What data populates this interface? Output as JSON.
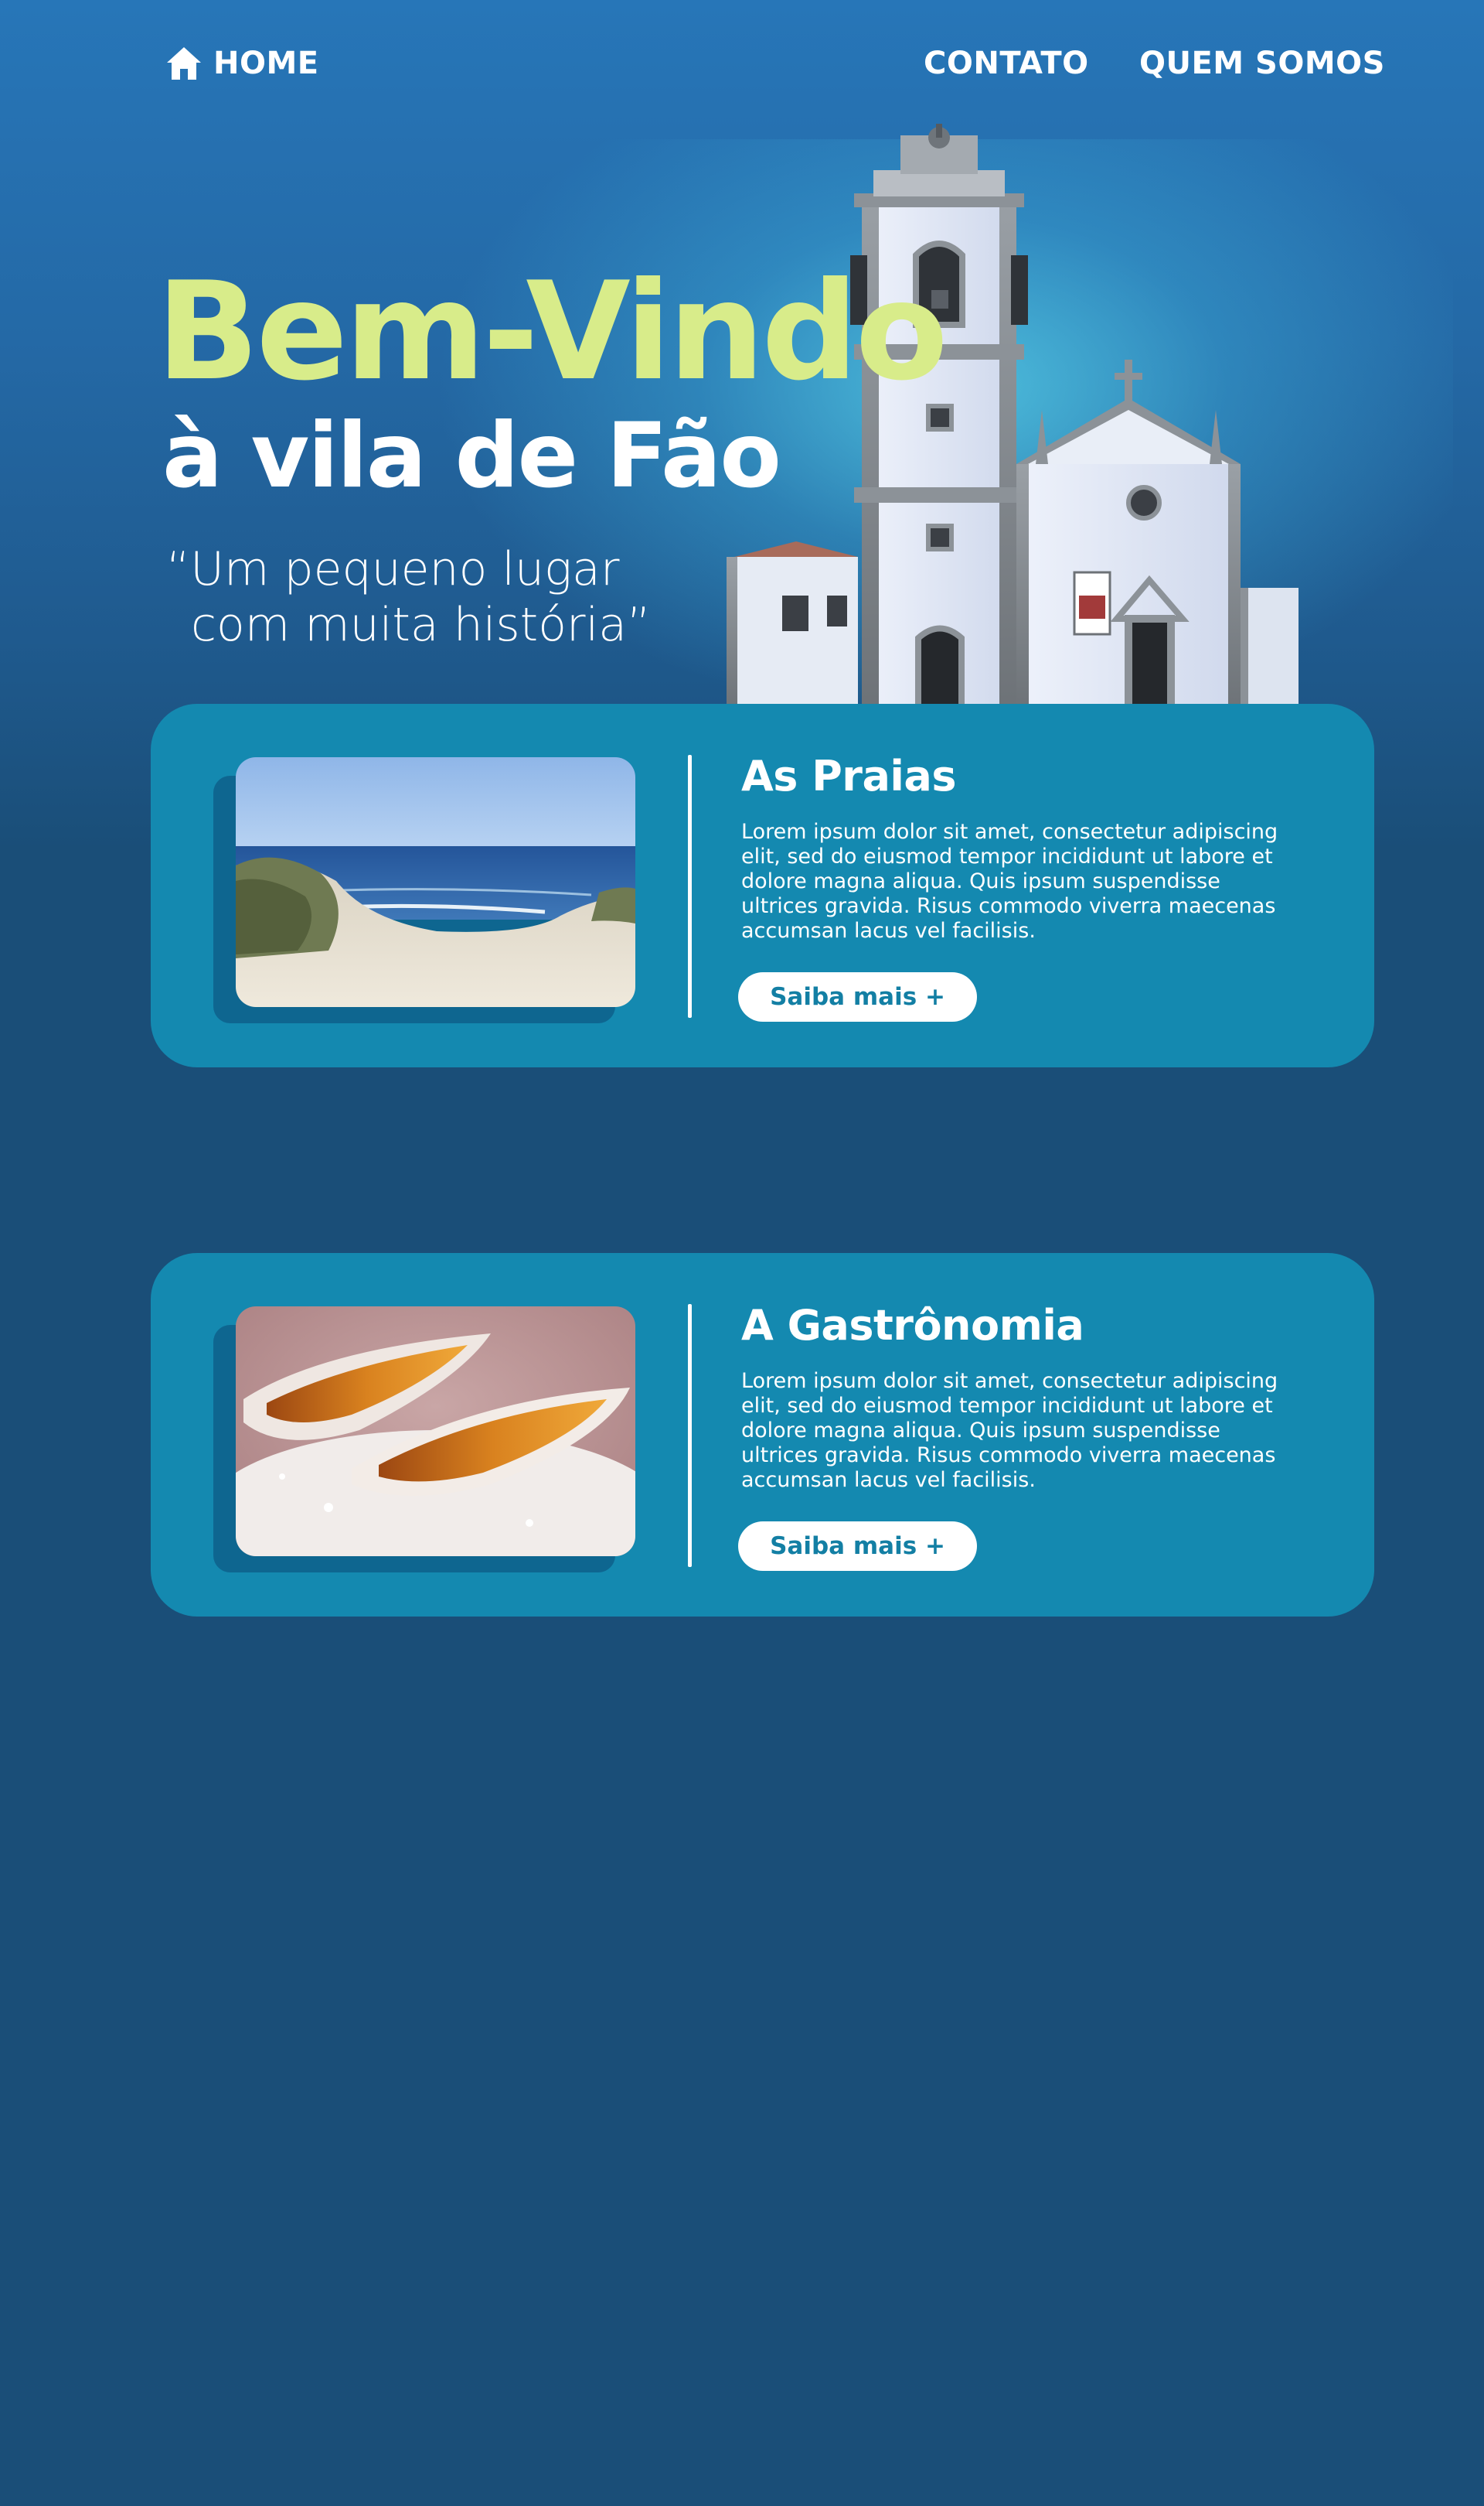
{
  "nav": {
    "home_label": "HOME",
    "contact_label": "CONTATO",
    "about_label": "QUEM SOMOS"
  },
  "hero": {
    "title": "Bem-Vindo",
    "subtitle": "à vila de Fão",
    "quote_line1": "“Um pequeno lugar",
    "quote_line2": "com muita história”"
  },
  "cards": [
    {
      "title": "As Praias",
      "text": "Lorem ipsum dolor sit amet, consectetur adipiscing elit, sed do eiusmod tempor incididunt ut labore et dolore magna aliqua. Quis ipsum suspendisse ultrices gravida. Risus commodo viverra maecenas accumsan lacus vel facilisis.",
      "button_label": "Saiba mais +",
      "image": "beach-dunes-photo"
    },
    {
      "title": "A Gastrônomia",
      "text": "Lorem ipsum dolor sit amet, consectetur adipiscing elit, sed do eiusmod tempor incididunt ut labore et dolore magna aliqua. Quis ipsum suspendisse ultrices gravida. Risus commodo viverra maecenas accumsan lacus vel facilisis.",
      "button_label": "Saiba mais +",
      "image": "pastry-photo"
    }
  ],
  "colors": {
    "background": "#1a4e78",
    "hero_top": "#2776b8",
    "title_green": "#d8ec8a",
    "card": "#1489b0",
    "card_shadow": "#0e6690",
    "button_text": "#137fa4"
  }
}
